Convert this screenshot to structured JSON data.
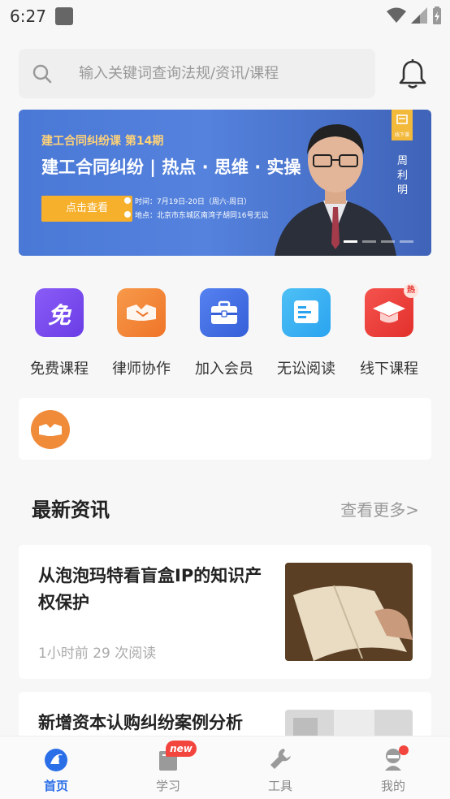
{
  "status_bar": {
    "time": "6:27"
  },
  "search": {
    "placeholder": "输入关键词查询法规/资讯/课程"
  },
  "banner": {
    "subtitle": "建工合同纠纷课 第14期",
    "title": "建工合同纠纷 | 热点 · 思维 · 实操",
    "cta": "点击查看",
    "time_line": "时间：7月19日-20日（周六-周日）",
    "place_line": "地点：北京市东城区南湾子胡同16号无讼",
    "tag": "线下课",
    "lecturer": "周利明",
    "colors": {
      "background": "#4a78d6",
      "cta": "#f7b02b",
      "subtitle": "#ffd278"
    }
  },
  "quick_entries": [
    {
      "label": "免费课程",
      "icon": "free-course-icon",
      "glyph": "免",
      "color": "#7a4df0"
    },
    {
      "label": "律师协作",
      "icon": "handshake-icon",
      "color": "#f07d32"
    },
    {
      "label": "加入会员",
      "icon": "briefcase-icon",
      "color": "#3f6fe0"
    },
    {
      "label": "无讼阅读",
      "icon": "reading-icon",
      "color": "#2aa4f0"
    },
    {
      "label": "线下课程",
      "icon": "graduation-cap-icon",
      "badge": "热",
      "color": "#f0413c"
    }
  ],
  "news": {
    "heading": "最新资讯",
    "more": "查看更多>",
    "items": [
      {
        "title": "从泡泡玛特看盲盒IP的知识产权保护",
        "meta": "1小时前 29 次阅读"
      },
      {
        "title": "新增资本认购纠纷案例分析"
      }
    ]
  },
  "tabbar": {
    "items": [
      {
        "label": "首页",
        "icon": "home-icon",
        "active": true
      },
      {
        "label": "学习",
        "icon": "study-icon",
        "badge": "new"
      },
      {
        "label": "工具",
        "icon": "tool-icon"
      },
      {
        "label": "我的",
        "icon": "profile-icon",
        "dot": true
      }
    ]
  },
  "colors": {
    "accent": "#2b6fe8",
    "badge_red": "#f2453d"
  }
}
